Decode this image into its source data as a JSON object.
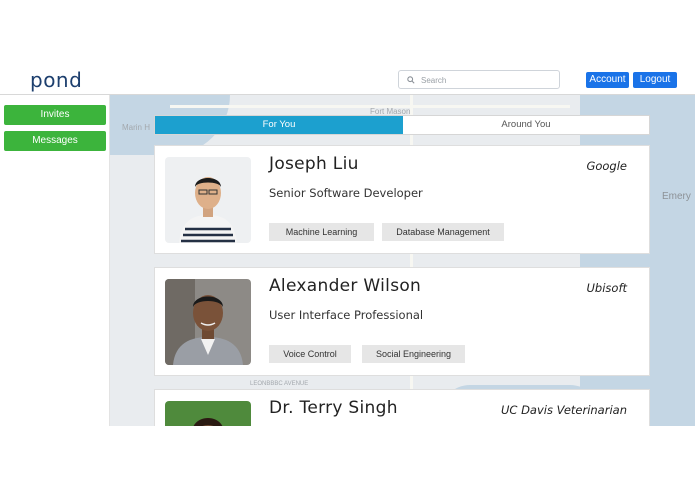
{
  "header": {
    "logo": "pond",
    "search_placeholder": "Search",
    "account_label": "Account",
    "logout_label": "Logout"
  },
  "sidebar": {
    "items": [
      {
        "label": "Invites"
      },
      {
        "label": "Messages"
      }
    ]
  },
  "map_labels": [
    "Marin H",
    "Fort Mason",
    "Emery",
    "LEONBBBC AVENUE"
  ],
  "tabs": [
    {
      "label": "For You",
      "active": true
    },
    {
      "label": "Around You",
      "active": false
    }
  ],
  "cards": [
    {
      "name": "Joseph Liu",
      "title": "Senior Software Developer",
      "company": "Google",
      "tags": [
        "Machine Learning",
        "Database Management"
      ]
    },
    {
      "name": "Alexander Wilson",
      "title": "User Interface Professional",
      "company": "Ubisoft",
      "tags": [
        "Voice Control",
        "Social Engineering"
      ]
    },
    {
      "name": "Dr. Terry Singh",
      "title": "",
      "company": "UC Davis Veterinarian",
      "tags": []
    }
  ],
  "colors": {
    "brand": "#1d3f6e",
    "header_button": "#1a73e8",
    "sidebar_button": "#3cb43c",
    "active_tab": "#1ca0cf",
    "tag_bg": "#e6e6e6"
  },
  "icons": {
    "search": "search-icon"
  }
}
